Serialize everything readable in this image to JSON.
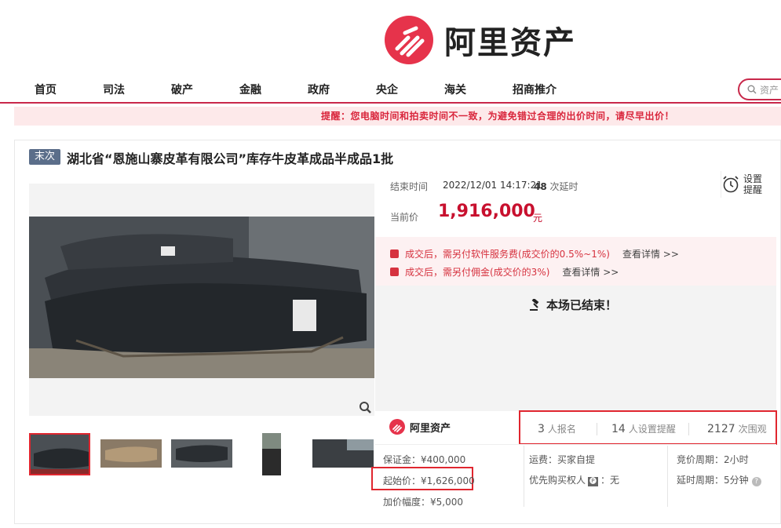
{
  "header": {
    "logo_text": "阿里资产",
    "nav": [
      "首页",
      "司法",
      "破产",
      "金融",
      "政府",
      "央企",
      "海关",
      "招商推介"
    ],
    "search_placeholder": "资产"
  },
  "notice": "提醒：您电脑时间和拍卖时间不一致，为避免错过合理的出价时间，请尽早出价！",
  "item": {
    "badge": "末次",
    "title": "湖北省“恩施山寨皮革有限公司”库存牛皮革成品半成品1批"
  },
  "auction": {
    "end_label": "结束时间",
    "end_time": "2022/12/01 14:17:21",
    "delay_count": "48",
    "delay_suffix": "次延时",
    "remind_label": "设置提醒",
    "price_label": "当前价",
    "price": "1,916,000",
    "price_unit": "元",
    "fees": [
      {
        "text": "成交后，需另付软件服务费(成交价的0.5%~1%)",
        "link": "查看详情 >>"
      },
      {
        "text": "成交后，需另付佣金(成交价的3%)",
        "link": "查看详情 >>"
      }
    ],
    "status": "本场已结束！"
  },
  "footer_logo": "阿里资产",
  "stats": [
    {
      "num": "3",
      "label": "人报名"
    },
    {
      "num": "14",
      "label": "人设置提醒"
    },
    {
      "num": "2127",
      "label": "次围观"
    }
  ],
  "details": {
    "deposit": "保证金：¥400,000",
    "start_price": "起始价：¥1,626,000",
    "increment": "加价幅度：¥5,000",
    "shipping": "运费：买家自提",
    "priority_label": "优先购买权人",
    "priority_tag": "🅟",
    "priority_value": "：无",
    "cycle": "竞价周期：2小时",
    "extension": "延时周期：5分钟",
    "help": "?"
  },
  "colors": {
    "brand": "#e6334b",
    "price": "#c8102e",
    "highlight": "#e0262f"
  }
}
